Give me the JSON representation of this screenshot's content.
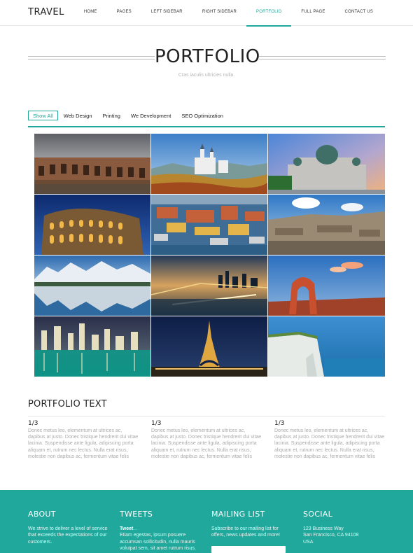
{
  "header": {
    "logo": "TRAVEL",
    "nav": [
      {
        "label": "HOME"
      },
      {
        "label": "PAGES"
      },
      {
        "label": "LEFT SIDEBAR"
      },
      {
        "label": "RIGHT SIDEBAR"
      },
      {
        "label": "PORTFOLIO",
        "active": true
      },
      {
        "label": "FULL PAGE"
      },
      {
        "label": "CONTACT US"
      }
    ]
  },
  "page": {
    "title": "PORTFOLIO",
    "subtitle": "Cras iaculis ultricies nulla."
  },
  "filters": [
    {
      "label": "Show All",
      "active": true
    },
    {
      "label": "Web Design"
    },
    {
      "label": "Printing"
    },
    {
      "label": "We Development"
    },
    {
      "label": "SEO Optimization"
    }
  ],
  "gallery": [
    {
      "subject": "roman-ruins-image"
    },
    {
      "subject": "castle-image"
    },
    {
      "subject": "cathedral-image"
    },
    {
      "subject": "colosseum-image"
    },
    {
      "subject": "city-aerial-image"
    },
    {
      "subject": "stone-wall-image"
    },
    {
      "subject": "mountain-lake-image"
    },
    {
      "subject": "bridge-night-image"
    },
    {
      "subject": "arch-rock-image"
    },
    {
      "subject": "skyline-night-image"
    },
    {
      "subject": "eiffel-tower-image"
    },
    {
      "subject": "sea-cliffs-image"
    }
  ],
  "portfolio_text": {
    "title": "PORTFOLIO TEXT",
    "columns": [
      {
        "heading": "1/3",
        "body": "Donec metus leo, elementum at ultrices ac, dapibus at justo. Donec tristique hendrerit dui vitae lacinia. Suspendisse ante ligula, adipiscing porta aliquam et, rutrum nec lectus. Nulla erat risus, molestie non dapibus ac, fermentum vitae felis"
      },
      {
        "heading": "1/3",
        "body": "Donec metus leo, elementum at ultrices ac, dapibus at justo. Donec tristique hendrerit dui vitae lacinia. Suspendisse ante ligula, adipiscing porta aliquam et, rutrum nec lectus. Nulla erat risus, molestie non dapibus ac, fermentum vitae felis"
      },
      {
        "heading": "1/3",
        "body": "Donec metus leo, elementum at ultrices ac, dapibus at justo. Donec tristique hendrerit dui vitae lacinia. Suspendisse ante ligula, adipiscing porta aliquam et, rutrum nec lectus. Nulla erat risus, molestie non dapibus ac, fermentum vitae felis"
      }
    ]
  },
  "footer": {
    "about": {
      "heading": "ABOUT",
      "text": "We strive to deliver a level of service that exceeds the expectations of our customers."
    },
    "tweets": {
      "heading": "TWEETS",
      "label": "Tweet",
      "tag": "...",
      "text": "Etiam egestas, ipsum posuere accumsan sollicitudin, nulla mauris volutpat sem, sit amet rutrum risus."
    },
    "mailing": {
      "heading": "MAILING LIST",
      "text": "Subscribe to our mailing list for offers, news updates and more!"
    },
    "social": {
      "heading": "SOCIAL",
      "line1": "123 Business Way",
      "line2": "San Francisco, CA 94108",
      "line3": "USA"
    }
  },
  "colors": {
    "accent": "#1fa89b",
    "footer_bg": "#1fa89b",
    "muted_text": "#aaaaaa"
  }
}
